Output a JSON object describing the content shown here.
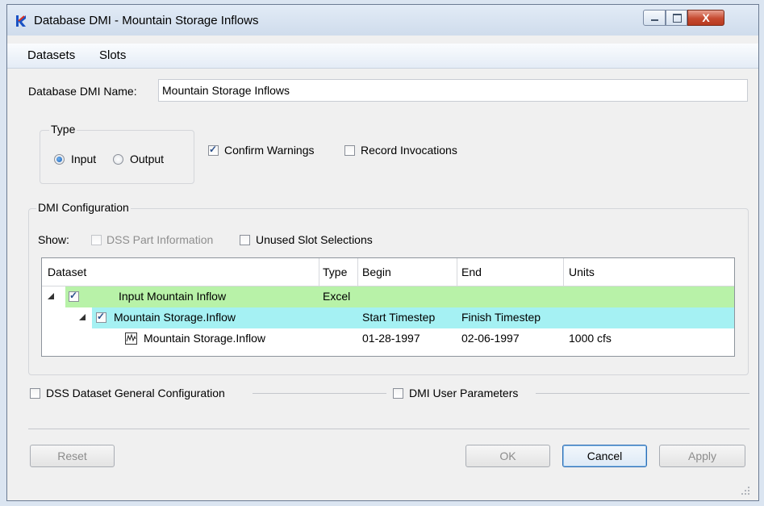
{
  "window": {
    "title": "Database DMI - Mountain Storage Inflows",
    "close_glyph": "X"
  },
  "menu": [
    "Datasets",
    "Slots"
  ],
  "dmi_name": {
    "label": "Database DMI Name:",
    "value": "Mountain Storage Inflows"
  },
  "type_group": {
    "title": "Type",
    "input_label": "Input",
    "output_label": "Output",
    "selected": "Input"
  },
  "confirm_warnings": {
    "label": "Confirm Warnings",
    "checked": true
  },
  "record_invocations": {
    "label": "Record Invocations",
    "checked": false
  },
  "dmi_config": {
    "title": "DMI Configuration",
    "show_label": "Show:",
    "dss_part_info": {
      "label": "DSS Part Information",
      "checked": false,
      "enabled": false
    },
    "unused_slot_selections": {
      "label": "Unused Slot Selections",
      "checked": false
    },
    "columns": [
      "Dataset",
      "Type",
      "Begin",
      "End",
      "Units"
    ],
    "rows": [
      {
        "dataset": "Input Mountain Inflow",
        "type": "Excel",
        "begin": "",
        "end": "",
        "units": "",
        "checked": true,
        "color": "#b8f2a8"
      },
      {
        "dataset": "Mountain Storage.Inflow",
        "type": "",
        "begin": "Start Timestep",
        "end": "Finish Timestep",
        "units": "",
        "checked": true,
        "color": "#a5f1f3"
      },
      {
        "dataset": "Mountain Storage.Inflow",
        "type": "",
        "begin": "01-28-1997",
        "end": "02-06-1997",
        "units": "1000 cfs",
        "icon": "timeseries-slot-icon"
      }
    ]
  },
  "dss_general": {
    "label": "DSS Dataset General Configuration",
    "checked": false
  },
  "dmi_user_params": {
    "label": "DMI User Parameters",
    "checked": false
  },
  "buttons": {
    "reset": "Reset",
    "ok": "OK",
    "cancel": "Cancel",
    "apply": "Apply"
  }
}
